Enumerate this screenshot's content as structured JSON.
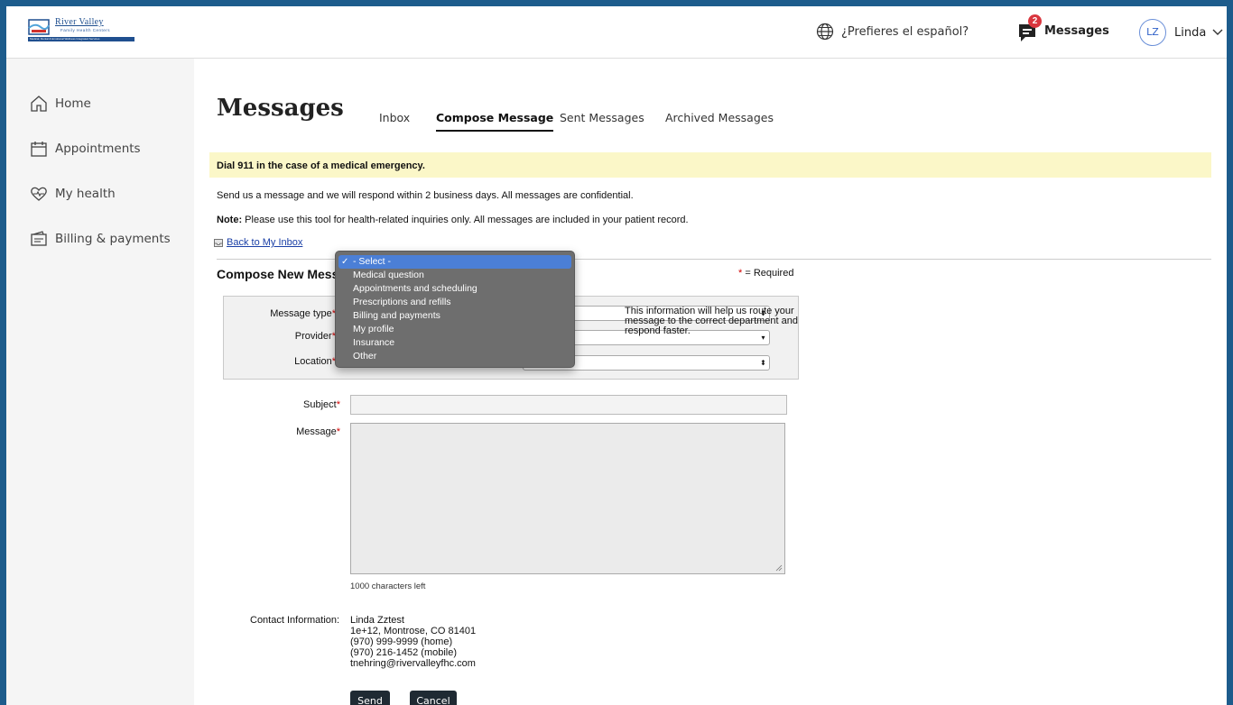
{
  "header": {
    "brand_name": "River Valley",
    "brand_tagline": "Family Health Centers",
    "brand_strip": "Medical, Dental & Emotional Wellness Integrated Services",
    "language_link": "¿Prefieres el español?",
    "messages_label": "Messages",
    "messages_badge": "2",
    "user_initials": "LZ",
    "user_name": "Linda"
  },
  "sidebar": {
    "items": [
      {
        "label": "Home",
        "icon": "home-icon"
      },
      {
        "label": "Appointments",
        "icon": "calendar-icon"
      },
      {
        "label": "My health",
        "icon": "heart-pulse-icon"
      },
      {
        "label": "Billing & payments",
        "icon": "wallet-icon"
      }
    ]
  },
  "page": {
    "title": "Messages",
    "tabs": [
      "Inbox",
      "Compose Message",
      "Sent Messages",
      "Archived Messages"
    ],
    "active_tab": "Compose Message",
    "alert": "Dial 911 in the case of a medical emergency.",
    "intro": "Send us a message and we will respond within 2 business days. All messages are confidential.",
    "note_label": "Note:",
    "note_text": " Please use this tool for health-related inquiries only. All messages are included in your patient record.",
    "back_link": "Back to My Inbox"
  },
  "form": {
    "section_title": "Compose New Message",
    "required_star": "*",
    "required_note": " = Required",
    "message_type_label": "Message type",
    "provider_label": "Provider",
    "location_label": "Location",
    "routing_info": "This information will help us route your message to the correct department and respond faster.",
    "subject_label": "Subject",
    "message_label": "Message",
    "chars_left": "1000 characters left",
    "contact_label": "Contact Information:",
    "contact_lines": [
      "Linda Zztest",
      "1e+12, Montrose, CO 81401",
      "(970) 999-9999 (home)",
      "(970) 216-1452 (mobile)",
      "tnehring@rivervalleyfhc.com"
    ],
    "send_label": "Send",
    "cancel_label": "Cancel"
  },
  "dropdown": {
    "options": [
      "- Select -",
      "Medical question",
      "Appointments and scheduling",
      "Prescriptions and refills",
      "Billing and payments",
      "My profile",
      "Insurance",
      "Other"
    ],
    "selected": "- Select -",
    "check_glyph": "✓"
  },
  "colors": {
    "frame": "#1d5c8c",
    "alert_bg": "#fbf7c8",
    "badge": "#d9363e",
    "dropdown_bg": "#6e6e6e",
    "dropdown_selected": "#4b7fd6",
    "button_bg": "#1f2a33"
  }
}
